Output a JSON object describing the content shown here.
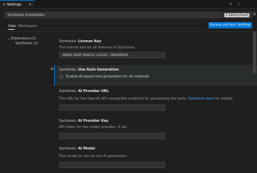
{
  "tab": {
    "icon": "settings-icon",
    "label": "Settings",
    "close": "×"
  },
  "window_actions": "⇆ ▯ ···",
  "search": {
    "value": "Synthesis Installation",
    "badge": "1 Setting Found",
    "filter_icon": "filter-icon"
  },
  "scopes": {
    "user": "User",
    "workspace": "Workspace"
  },
  "sync_button": "Backup and Sync Settings",
  "toc": {
    "extensions": "Extensions (1)",
    "item": "Synthesis (1)"
  },
  "settings": [
    {
      "prefix": "Synthesis: ",
      "title": "License Key",
      "desc": "The license key for all features of Synthesis.",
      "value": "00XHQ-BOSM-MS8CGX-4SSGSS-1XRUXPBSUA"
    },
    {
      "prefix": "Synthesis: ",
      "title": "Use Auto Generation",
      "checkbox_label": "Enable AI-based test generation for all methods"
    },
    {
      "prefix": "Synthesis: ",
      "title": "AI Provider URL",
      "desc_start": "The URL for the OpenAI API compatible endpoint for generating the tests.",
      "link": "Synthesis docs",
      "desc_end": "for details."
    },
    {
      "prefix": "Synthesis: ",
      "title": "AI Provider Key",
      "desc": "API token for the model provider, if set."
    },
    {
      "prefix": "Synthesis: ",
      "title": "AI Model",
      "desc": "The model to use for the AI generation."
    }
  ]
}
